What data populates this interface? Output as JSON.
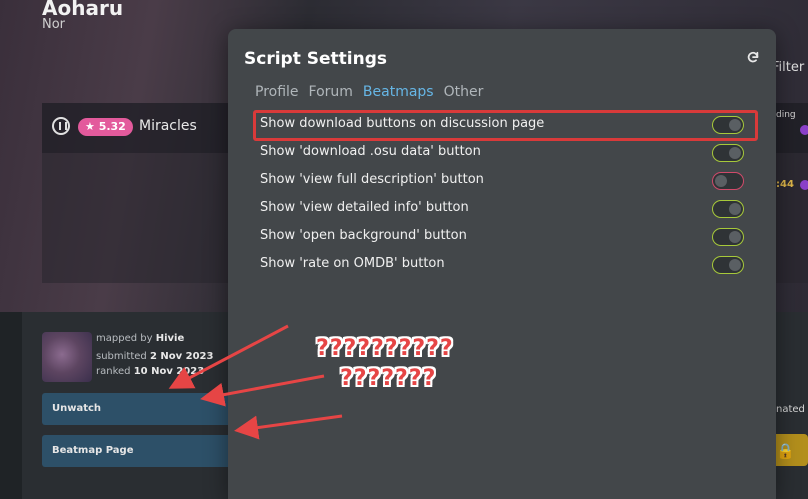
{
  "background": {
    "title": "Aoharu",
    "artist": "Nor",
    "star_rating": "★ 5.32",
    "difficulty": "Miracles",
    "mapper_prefix": "mapped by",
    "mapper_name": "Hivie",
    "submitted_prefix": "submitted",
    "submitted_date": "2 Nov 2023",
    "ranked_prefix": "ranked",
    "ranked_date": "10 Nov 2023",
    "buttons": [
      "Unwatch",
      "Beatmap Page"
    ],
    "filter_fragment": "Filter",
    "pending_fragment": "ding",
    "time_fragment": ":44",
    "nated_fragment": "nated",
    "lock_icon": "lock-icon",
    "mode_icon": "osu-mode-icon"
  },
  "modal": {
    "title": "Script Settings",
    "refresh_icon": "refresh-icon",
    "tabs": [
      {
        "label": "Profile",
        "active": false
      },
      {
        "label": "Forum",
        "active": false
      },
      {
        "label": "Beatmaps",
        "active": true
      },
      {
        "label": "Other",
        "active": false
      }
    ],
    "settings": [
      {
        "label": "Show download buttons on discussion page",
        "enabled": true
      },
      {
        "label": "Show 'download .osu data' button",
        "enabled": true
      },
      {
        "label": "Show 'view full description' button",
        "enabled": false
      },
      {
        "label": "Show 'view detailed info' button",
        "enabled": true
      },
      {
        "label": "Show 'open background' button",
        "enabled": true
      },
      {
        "label": "Show 'rate on OMDB' button",
        "enabled": true
      }
    ]
  },
  "annotation": {
    "line1": "??????????",
    "line2": "???????",
    "color": "#e64545"
  },
  "colors": {
    "accent_tab": "#66b6e6",
    "toggle_on": "#a7c93a",
    "toggle_off": "#d04a6a",
    "highlight": "#d93a3a",
    "button": "#2d5068"
  }
}
